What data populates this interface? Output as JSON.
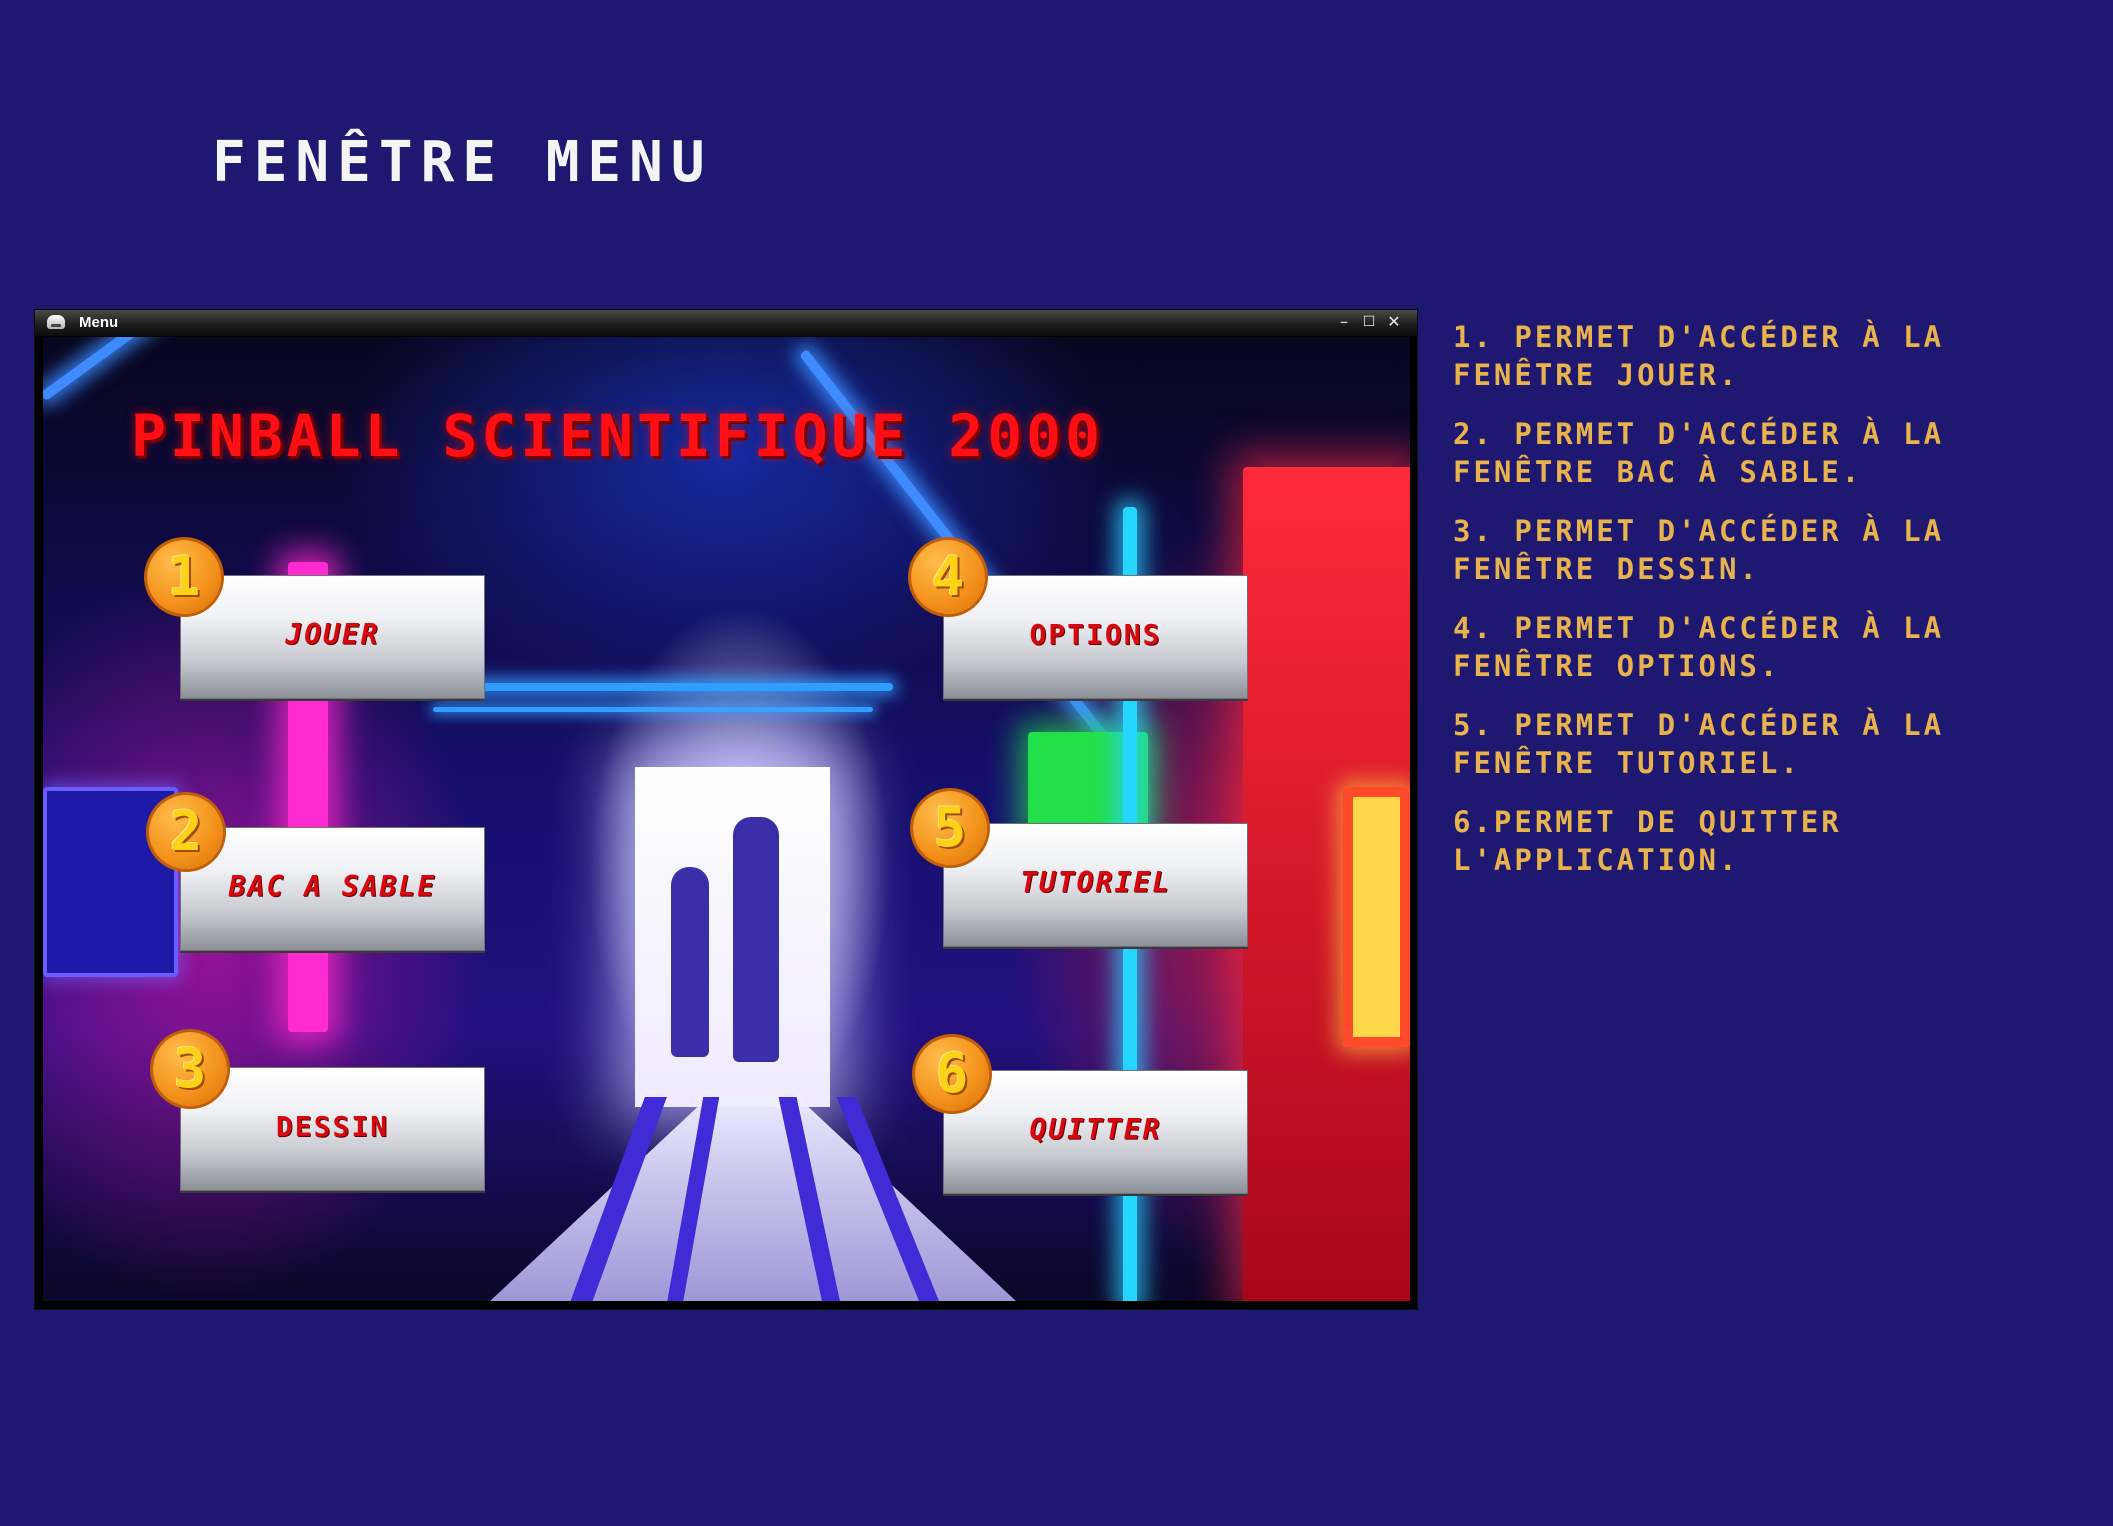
{
  "page": {
    "title": "FENÊTRE MENU"
  },
  "window": {
    "title": "Menu",
    "controls": {
      "minimize_glyph": "–",
      "maximize_glyph": "☐",
      "close_glyph": "✕"
    }
  },
  "menu": {
    "game_title": "PINBALL SCIENTIFIQUE 2000",
    "buttons": [
      {
        "number": "1",
        "label": "JOUER",
        "icon": "number-badge-1"
      },
      {
        "number": "2",
        "label": "BAC A SABLE",
        "icon": "number-badge-2"
      },
      {
        "number": "3",
        "label": "DESSIN",
        "icon": "number-badge-3"
      },
      {
        "number": "4",
        "label": "OPTIONS",
        "icon": "number-badge-4"
      },
      {
        "number": "5",
        "label": "TUTORIEL",
        "icon": "number-badge-5"
      },
      {
        "number": "6",
        "label": "QUITTER",
        "icon": "number-badge-6"
      }
    ]
  },
  "descriptions": [
    "1. PERMET D'ACCÉDER À LA FENÊTRE JOUER.",
    "2. PERMET D'ACCÉDER À LA FENÊTRE BAC À SABLE.",
    "3. PERMET D'ACCÉDER À LA FENÊTRE DESSIN.",
    "4. PERMET D'ACCÉDER À LA FENÊTRE OPTIONS.",
    "5. PERMET D'ACCÉDER À LA FENÊTRE TUTORIEL.",
    "6.PERMET DE QUITTER L'APPLICATION."
  ],
  "colors": {
    "page_background": "#1f1870",
    "title_text": "#f4f4f4",
    "description_text": "#e8b24c",
    "game_title": "#ff0e14",
    "button_label": "#d9080e",
    "badge": "#f3901a"
  }
}
